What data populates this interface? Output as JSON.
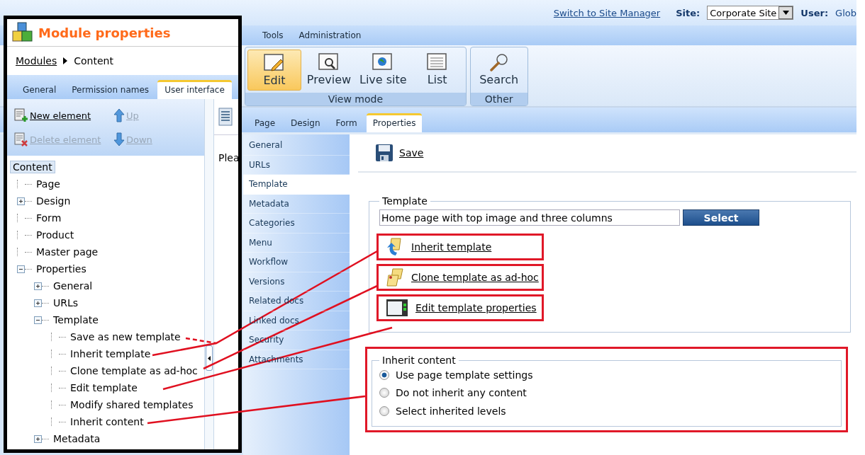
{
  "header": {
    "site_manager_link": "Switch to Site Manager",
    "site_label": "Site:",
    "site_value": "Corporate Site",
    "user_label": "User:",
    "user_value": "Glob"
  },
  "menu": [
    "Tools",
    "Administration"
  ],
  "ribbon": {
    "groups": [
      {
        "label": "View mode",
        "buttons": [
          {
            "label": "Edit",
            "kind": "edit",
            "selected": true
          },
          {
            "label": "Preview",
            "kind": "preview",
            "selected": false
          },
          {
            "label": "Live site",
            "kind": "globe",
            "selected": false
          },
          {
            "label": "List",
            "kind": "list",
            "selected": false
          }
        ]
      },
      {
        "label": "Other",
        "buttons": [
          {
            "label": "Search",
            "kind": "search",
            "selected": false
          }
        ]
      }
    ]
  },
  "tabs": [
    {
      "label": "Page",
      "selected": false
    },
    {
      "label": "Design",
      "selected": false
    },
    {
      "label": "Form",
      "selected": false
    },
    {
      "label": "Properties",
      "selected": true
    }
  ],
  "side_menu": [
    {
      "label": "General",
      "selected": false
    },
    {
      "label": "URLs",
      "selected": false
    },
    {
      "label": "Template",
      "selected": true
    },
    {
      "label": "Metadata",
      "selected": false
    },
    {
      "label": "Categories",
      "selected": false
    },
    {
      "label": "Menu",
      "selected": false
    },
    {
      "label": "Workflow",
      "selected": false
    },
    {
      "label": "Versions",
      "selected": false
    },
    {
      "label": "Related docs",
      "selected": false
    },
    {
      "label": "Linked docs",
      "selected": false
    },
    {
      "label": "Security",
      "selected": false
    },
    {
      "label": "Attachments",
      "selected": false
    }
  ],
  "save_button": "Save",
  "template_section": {
    "legend": "Template",
    "value": "Home page with top image and three columns",
    "select_button": "Select",
    "links": [
      {
        "label": "Inherit template",
        "kind": "inherit",
        "highlighted": true
      },
      {
        "label": "Clone template as ad-hoc",
        "kind": "clone",
        "highlighted": true
      },
      {
        "label": "Edit template properties",
        "kind": "properties",
        "highlighted": true
      }
    ]
  },
  "inherit_content": {
    "legend": "Inherit content",
    "highlighted": true,
    "options": [
      {
        "label": "Use page template settings",
        "selected": true
      },
      {
        "label": "Do not inherit any content",
        "selected": false
      },
      {
        "label": "Select inherited levels",
        "selected": false
      }
    ]
  },
  "module_panel": {
    "title": "Module properties",
    "breadcrumb": {
      "link": "Modules",
      "current": "Content"
    },
    "tabs": [
      {
        "label": "General",
        "selected": false
      },
      {
        "label": "Permission names",
        "selected": false
      },
      {
        "label": "User interface",
        "selected": true
      }
    ],
    "toolbar": [
      {
        "label": "New element",
        "kind": "new",
        "disabled": false
      },
      {
        "label": "Up",
        "kind": "up",
        "disabled": true
      },
      {
        "label": "Delete element",
        "kind": "delete",
        "disabled": true
      },
      {
        "label": "Down",
        "kind": "down",
        "disabled": true
      }
    ],
    "tree": [
      {
        "label": "Content",
        "selected": true,
        "children": [
          {
            "label": "Page",
            "selected": false
          },
          {
            "label": "Design",
            "selected": false,
            "expanded": false
          },
          {
            "label": "Form",
            "selected": false
          },
          {
            "label": "Product",
            "selected": false
          },
          {
            "label": "Master page",
            "selected": false
          },
          {
            "label": "Properties",
            "selected": false,
            "expanded": true,
            "children": [
              {
                "label": "General",
                "selected": false,
                "expanded": false
              },
              {
                "label": "URLs",
                "selected": false,
                "expanded": false
              },
              {
                "label": "Template",
                "selected": false,
                "expanded": true,
                "children": [
                  {
                    "label": "Save as new template",
                    "selected": false
                  },
                  {
                    "label": "Inherit template",
                    "selected": false
                  },
                  {
                    "label": "Clone template as ad-hoc",
                    "selected": false
                  },
                  {
                    "label": "Edit template",
                    "selected": false
                  },
                  {
                    "label": "Modify shared templates",
                    "selected": false
                  },
                  {
                    "label": "Inherit content",
                    "selected": false
                  }
                ]
              },
              {
                "label": "Metadata",
                "selected": false,
                "expanded": false
              }
            ]
          }
        ]
      }
    ],
    "preview_text": "Plea"
  }
}
